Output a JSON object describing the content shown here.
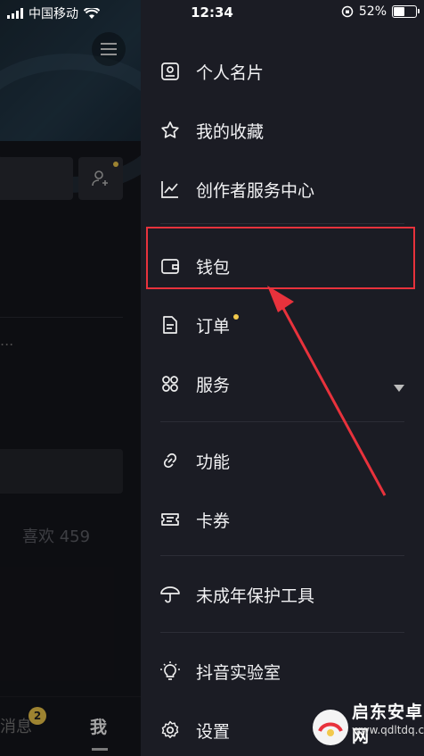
{
  "status_bar": {
    "carrier": "中国移动",
    "time": "12:34",
    "battery_percent": "52%"
  },
  "background": {
    "likes_label": "喜欢 459",
    "tabs": {
      "messages": "消息",
      "messages_badge": "2",
      "me": "我"
    },
    "ellipsis": "..."
  },
  "drawer": {
    "items": [
      {
        "label": "个人名片",
        "icon": "id-card-icon"
      },
      {
        "label": "我的收藏",
        "icon": "star-icon"
      },
      {
        "label": "创作者服务中心",
        "icon": "chart-line-icon"
      },
      {
        "label": "钱包",
        "icon": "wallet-icon"
      },
      {
        "label": "订单",
        "icon": "document-icon"
      },
      {
        "label": "服务",
        "icon": "grid-clover-icon"
      },
      {
        "label": "功能",
        "icon": "link-icon"
      },
      {
        "label": "卡券",
        "icon": "ticket-icon"
      },
      {
        "label": "未成年保护工具",
        "icon": "umbrella-icon"
      },
      {
        "label": "抖音实验室",
        "icon": "bulb-icon"
      },
      {
        "label": "设置",
        "icon": "gear-icon"
      }
    ]
  },
  "watermark": {
    "name": "启东安卓网",
    "url": "www.qdltdq.com"
  },
  "colors": {
    "accent_yellow": "#f2c94c",
    "highlight_red": "#e8323c",
    "drawer_bg": "#1b1c24"
  }
}
